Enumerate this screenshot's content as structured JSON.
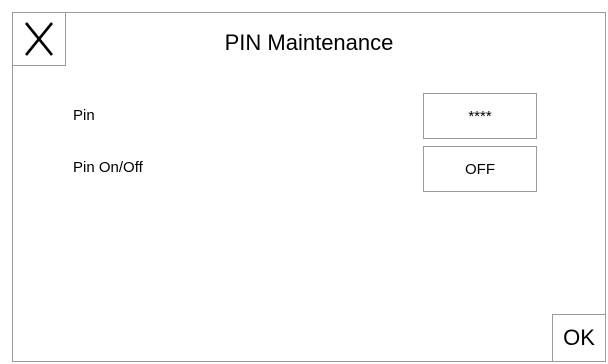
{
  "dialog": {
    "title": "PIN Maintenance",
    "close_icon": "close-x-icon",
    "ok_label": "OK"
  },
  "rows": [
    {
      "label": "Pin",
      "value": "****"
    },
    {
      "label": "Pin On/Off",
      "value": "OFF"
    }
  ]
}
